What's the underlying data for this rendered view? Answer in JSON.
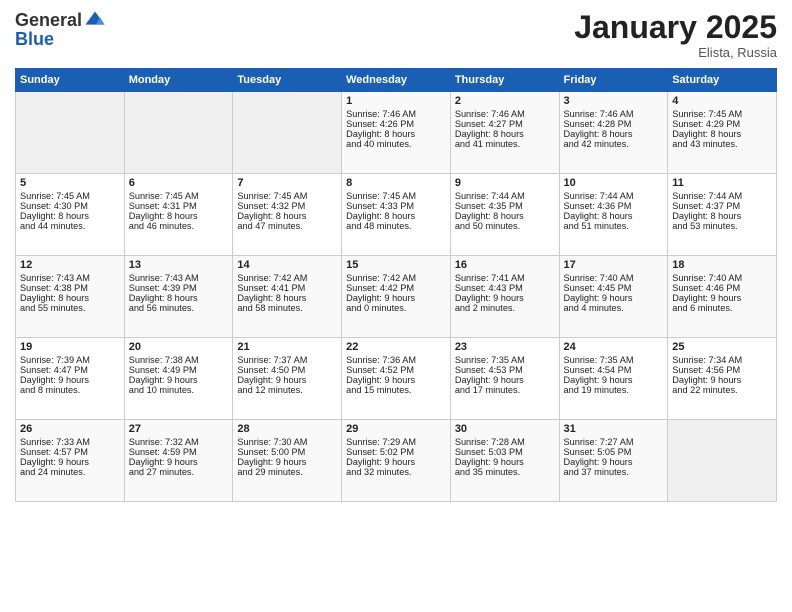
{
  "header": {
    "logo_line1": "General",
    "logo_line2": "Blue",
    "month": "January 2025",
    "location": "Elista, Russia"
  },
  "weekdays": [
    "Sunday",
    "Monday",
    "Tuesday",
    "Wednesday",
    "Thursday",
    "Friday",
    "Saturday"
  ],
  "weeks": [
    [
      {
        "day": "",
        "text": ""
      },
      {
        "day": "",
        "text": ""
      },
      {
        "day": "",
        "text": ""
      },
      {
        "day": "1",
        "text": "Sunrise: 7:46 AM\nSunset: 4:26 PM\nDaylight: 8 hours\nand 40 minutes."
      },
      {
        "day": "2",
        "text": "Sunrise: 7:46 AM\nSunset: 4:27 PM\nDaylight: 8 hours\nand 41 minutes."
      },
      {
        "day": "3",
        "text": "Sunrise: 7:46 AM\nSunset: 4:28 PM\nDaylight: 8 hours\nand 42 minutes."
      },
      {
        "day": "4",
        "text": "Sunrise: 7:45 AM\nSunset: 4:29 PM\nDaylight: 8 hours\nand 43 minutes."
      }
    ],
    [
      {
        "day": "5",
        "text": "Sunrise: 7:45 AM\nSunset: 4:30 PM\nDaylight: 8 hours\nand 44 minutes."
      },
      {
        "day": "6",
        "text": "Sunrise: 7:45 AM\nSunset: 4:31 PM\nDaylight: 8 hours\nand 46 minutes."
      },
      {
        "day": "7",
        "text": "Sunrise: 7:45 AM\nSunset: 4:32 PM\nDaylight: 8 hours\nand 47 minutes."
      },
      {
        "day": "8",
        "text": "Sunrise: 7:45 AM\nSunset: 4:33 PM\nDaylight: 8 hours\nand 48 minutes."
      },
      {
        "day": "9",
        "text": "Sunrise: 7:44 AM\nSunset: 4:35 PM\nDaylight: 8 hours\nand 50 minutes."
      },
      {
        "day": "10",
        "text": "Sunrise: 7:44 AM\nSunset: 4:36 PM\nDaylight: 8 hours\nand 51 minutes."
      },
      {
        "day": "11",
        "text": "Sunrise: 7:44 AM\nSunset: 4:37 PM\nDaylight: 8 hours\nand 53 minutes."
      }
    ],
    [
      {
        "day": "12",
        "text": "Sunrise: 7:43 AM\nSunset: 4:38 PM\nDaylight: 8 hours\nand 55 minutes."
      },
      {
        "day": "13",
        "text": "Sunrise: 7:43 AM\nSunset: 4:39 PM\nDaylight: 8 hours\nand 56 minutes."
      },
      {
        "day": "14",
        "text": "Sunrise: 7:42 AM\nSunset: 4:41 PM\nDaylight: 8 hours\nand 58 minutes."
      },
      {
        "day": "15",
        "text": "Sunrise: 7:42 AM\nSunset: 4:42 PM\nDaylight: 9 hours\nand 0 minutes."
      },
      {
        "day": "16",
        "text": "Sunrise: 7:41 AM\nSunset: 4:43 PM\nDaylight: 9 hours\nand 2 minutes."
      },
      {
        "day": "17",
        "text": "Sunrise: 7:40 AM\nSunset: 4:45 PM\nDaylight: 9 hours\nand 4 minutes."
      },
      {
        "day": "18",
        "text": "Sunrise: 7:40 AM\nSunset: 4:46 PM\nDaylight: 9 hours\nand 6 minutes."
      }
    ],
    [
      {
        "day": "19",
        "text": "Sunrise: 7:39 AM\nSunset: 4:47 PM\nDaylight: 9 hours\nand 8 minutes."
      },
      {
        "day": "20",
        "text": "Sunrise: 7:38 AM\nSunset: 4:49 PM\nDaylight: 9 hours\nand 10 minutes."
      },
      {
        "day": "21",
        "text": "Sunrise: 7:37 AM\nSunset: 4:50 PM\nDaylight: 9 hours\nand 12 minutes."
      },
      {
        "day": "22",
        "text": "Sunrise: 7:36 AM\nSunset: 4:52 PM\nDaylight: 9 hours\nand 15 minutes."
      },
      {
        "day": "23",
        "text": "Sunrise: 7:35 AM\nSunset: 4:53 PM\nDaylight: 9 hours\nand 17 minutes."
      },
      {
        "day": "24",
        "text": "Sunrise: 7:35 AM\nSunset: 4:54 PM\nDaylight: 9 hours\nand 19 minutes."
      },
      {
        "day": "25",
        "text": "Sunrise: 7:34 AM\nSunset: 4:56 PM\nDaylight: 9 hours\nand 22 minutes."
      }
    ],
    [
      {
        "day": "26",
        "text": "Sunrise: 7:33 AM\nSunset: 4:57 PM\nDaylight: 9 hours\nand 24 minutes."
      },
      {
        "day": "27",
        "text": "Sunrise: 7:32 AM\nSunset: 4:59 PM\nDaylight: 9 hours\nand 27 minutes."
      },
      {
        "day": "28",
        "text": "Sunrise: 7:30 AM\nSunset: 5:00 PM\nDaylight: 9 hours\nand 29 minutes."
      },
      {
        "day": "29",
        "text": "Sunrise: 7:29 AM\nSunset: 5:02 PM\nDaylight: 9 hours\nand 32 minutes."
      },
      {
        "day": "30",
        "text": "Sunrise: 7:28 AM\nSunset: 5:03 PM\nDaylight: 9 hours\nand 35 minutes."
      },
      {
        "day": "31",
        "text": "Sunrise: 7:27 AM\nSunset: 5:05 PM\nDaylight: 9 hours\nand 37 minutes."
      },
      {
        "day": "",
        "text": ""
      }
    ]
  ]
}
